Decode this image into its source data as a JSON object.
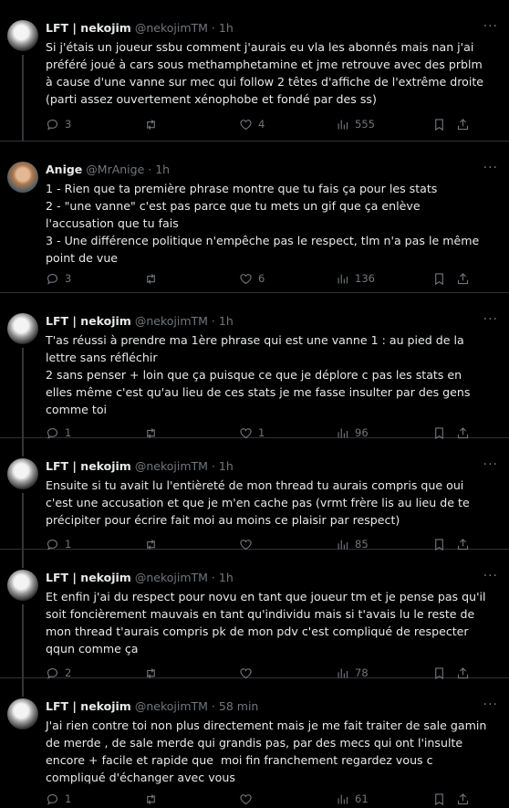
{
  "tweets": [
    {
      "name": "LFT | nekojim",
      "handle": "@nekojimTM",
      "sep": "·",
      "time": "1h",
      "text": "Si j'étais un joueur ssbu comment j'aurais eu vla les abonnés mais nan j'ai\npréféré joué à cars sous methamphetamine et jme retrouve avec des prblm\nà cause d'une vanne sur mec qui follow 2 têtes d'affiche de l'extrême droite\n(parti assez ouvertement xénophobe et fondé par des ss)",
      "replies": "3",
      "retweets": "",
      "likes": "4",
      "views": "555"
    },
    {
      "name": "Anige",
      "handle": "@MrAnige",
      "sep": "·",
      "time": "1h",
      "text": "1 - Rien que ta première phrase montre que tu fais ça pour les stats\n2 - \"une vanne\" c'est pas parce que tu mets un gif que ça enlève\nl'accusation que tu fais\n3 - Une différence politique n'empêche pas le respect, tlm n'a pas le même\npoint de vue",
      "replies": "3",
      "retweets": "",
      "likes": "6",
      "views": "136"
    },
    {
      "name": "LFT | nekojim",
      "handle": "@nekojimTM",
      "sep": "·",
      "time": "1h",
      "text": "T'as réussi à prendre ma 1ère phrase qui est une vanne 1 : au pied de la\nlettre sans réfléchir\n2 sans penser + loin que ça puisque ce que je déplore c pas les stats en\nelles même c'est qu'au lieu de ces stats je me fasse insulter par des gens\ncomme toi",
      "replies": "1",
      "retweets": "",
      "likes": "1",
      "views": "96"
    },
    {
      "name": "LFT | nekojim",
      "handle": "@nekojimTM",
      "sep": "·",
      "time": "1h",
      "text": "Ensuite si tu avait lu l'entièreté de mon thread tu aurais compris que oui\nc'est une accusation et que je m'en cache pas (vrmt frère lis au lieu de te\nprécipiter pour écrire fait moi au moins ce plaisir par respect)",
      "replies": "1",
      "retweets": "",
      "likes": "",
      "views": "85"
    },
    {
      "name": "LFT | nekojim",
      "handle": "@nekojimTM",
      "sep": "·",
      "time": "1h",
      "text": "Et enfin j'ai du respect pour novu en tant que joueur tm et je pense pas qu'il\nsoit foncièrement mauvais en tant qu'individu mais si t'avais lu le reste de\nmon thread t'aurais compris pk de mon pdv c'est compliqué de respecter\nqqun comme ça",
      "replies": "2",
      "retweets": "",
      "likes": "",
      "views": "78"
    },
    {
      "name": "LFT | nekojim",
      "handle": "@nekojimTM",
      "sep": "·",
      "time": "58 min",
      "text": "J'ai rien contre toi non plus directement mais je me fait traiter de sale gamin\nde merde , de sale merde qui grandis pas, par des mecs qui ont l'insulte\nencore + facile et rapide que  moi fin franchement regardez vous c\ncompliqué d'échanger avec vous",
      "replies": "1",
      "retweets": "",
      "likes": "",
      "views": "61"
    }
  ]
}
